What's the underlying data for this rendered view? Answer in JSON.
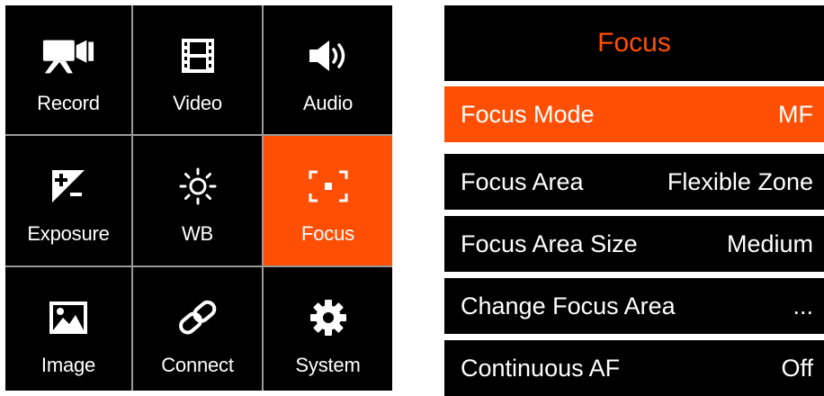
{
  "grid": {
    "cells": [
      {
        "label": "Record",
        "icon": "video-camera-icon"
      },
      {
        "label": "Video",
        "icon": "film-icon"
      },
      {
        "label": "Audio",
        "icon": "speaker-icon"
      },
      {
        "label": "Exposure",
        "icon": "exposure-icon"
      },
      {
        "label": "WB",
        "icon": "sun-icon"
      },
      {
        "label": "Focus",
        "icon": "focus-frame-icon",
        "selected": true
      },
      {
        "label": "Image",
        "icon": "image-icon"
      },
      {
        "label": "Connect",
        "icon": "link-icon"
      },
      {
        "label": "System",
        "icon": "gear-icon"
      }
    ]
  },
  "menu": {
    "title": "Focus",
    "items": [
      {
        "label": "Focus Mode",
        "value": "MF",
        "selected": true
      },
      {
        "label": "Focus Area",
        "value": "Flexible Zone"
      },
      {
        "label": "Focus Area Size",
        "value": "Medium"
      },
      {
        "label": "Change Focus Area",
        "value": "..."
      },
      {
        "label": "Continuous AF",
        "value": "Off"
      }
    ]
  },
  "colors": {
    "accent": "#ff4f05",
    "background": "#000000",
    "divider": "#9a9a9a",
    "text": "#ffffff"
  }
}
